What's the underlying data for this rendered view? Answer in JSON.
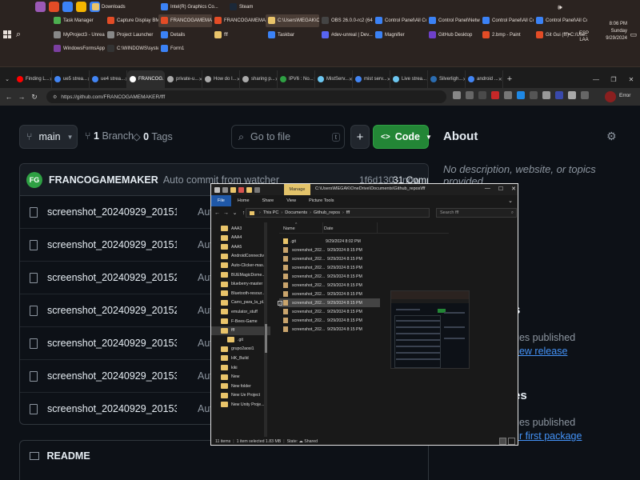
{
  "taskbar": {
    "row1": [
      {
        "label": "Downloads",
        "color": "#e9c46a"
      },
      {
        "label": "Intel(R) Graphics Co...",
        "color": "#3b82f6"
      },
      {
        "label": "Steam",
        "color": "#1b2838"
      }
    ],
    "row2": [
      {
        "label": "Task Manager",
        "color": "#4caf50"
      },
      {
        "label": "Capture Display BMP ...",
        "color": "#e34c26"
      },
      {
        "label": "FRANCOGAMEMAKE...",
        "color": "#e34c26",
        "active": true
      },
      {
        "label": "FRANCOGAMEMAKE...",
        "color": "#e34c26"
      },
      {
        "label": "C:\\Users\\MEGAK\\One...",
        "color": "#e9c46a",
        "active": true
      },
      {
        "label": "OBS 26.0.0-rc2 (64...",
        "color": "#444"
      },
      {
        "label": "Control Panel\\All Cont...",
        "color": "#3b82f6"
      },
      {
        "label": "Control Panel\\Networ...",
        "color": "#3b82f6"
      },
      {
        "label": "Control Panel\\All Cont...",
        "color": "#3b82f6"
      },
      {
        "label": "Control Panel\\All Cont...",
        "color": "#3b82f6"
      }
    ],
    "row3": [
      {
        "label": "MyProject3 - Unreal ...",
        "color": "#888"
      },
      {
        "label": "Project Launcher",
        "color": "#888"
      },
      {
        "label": "Details",
        "color": "#3b82f6"
      },
      {
        "label": "fff",
        "color": "#e9c46a"
      },
      {
        "label": "Taskbar",
        "color": "#3b82f6"
      },
      {
        "label": "#dev-unreal | Dev...",
        "color": "#5865f2"
      },
      {
        "label": "Magnifier",
        "color": "#3b82f6"
      },
      {
        "label": "GitHub Desktop",
        "color": "#6e40c9"
      },
      {
        "label": "2.bmp - Paint",
        "color": "#e34c26"
      },
      {
        "label": "Git Gui (fff) C:/Use...",
        "color": "#e34c26"
      }
    ],
    "row4": [
      {
        "label": "WindowsFormsApp13 - ...",
        "color": "#7b3fa0"
      },
      {
        "label": "C:\\WINDOWS\\system...",
        "color": "#333"
      },
      {
        "label": "Form1",
        "color": "#3b82f6"
      }
    ],
    "tray": {
      "time": "8:06 PM",
      "day": "Sunday",
      "date": "9/29/2024",
      "lang_line1": "ESP",
      "lang_line2": "LAA"
    }
  },
  "browser": {
    "tabs": [
      {
        "title": "Finding L...",
        "color": "#ff0000"
      },
      {
        "title": "ue5 strea...",
        "color": "#4285f4"
      },
      {
        "title": "ue4 strea...",
        "color": "#4285f4"
      },
      {
        "title": "FRANCOG...",
        "color": "#ffffff",
        "active": true
      },
      {
        "title": "private-u...",
        "color": "#aaa"
      },
      {
        "title": "How do I...",
        "color": "#aaa"
      },
      {
        "title": "sharing p...",
        "color": "#aaa"
      },
      {
        "title": "IPV6 : No...",
        "color": "#2ea043"
      },
      {
        "title": "MistServ...",
        "color": "#6cc6f0"
      },
      {
        "title": "mist serv...",
        "color": "#4285f4"
      },
      {
        "title": "Live strea...",
        "color": "#6cc6f0"
      },
      {
        "title": "Silverligh...",
        "color": "#2b6cb0"
      },
      {
        "title": "android ...",
        "color": "#4285f4"
      }
    ],
    "url": "https://github.com/FRANCOGAMEMAKER/fff",
    "profile_status": "Error"
  },
  "github": {
    "branch": "main",
    "branch_count": "1",
    "branch_label": "Branch",
    "tag_count": "0",
    "tag_label": "Tags",
    "goto_placeholder": "Go to file",
    "goto_kbd": "t",
    "plus": "+",
    "code_label": "Code",
    "commit": {
      "avatar": "FG",
      "author": "FRANCOGAMEMAKER",
      "message": "Auto commit from watcher",
      "hash": "1f6d130 · now",
      "commits": "31 Commits"
    },
    "files": [
      {
        "name": "screenshot_20240929_201514.b...",
        "msg": "Auto"
      },
      {
        "name": "screenshot_20240929_201518.b...",
        "msg": "Auto"
      },
      {
        "name": "screenshot_20240929_201522.b...",
        "msg": "Auto"
      },
      {
        "name": "screenshot_20240929_201526.b...",
        "msg": "Auto"
      },
      {
        "name": "screenshot_20240929_201530.b...",
        "msg": "Auto"
      },
      {
        "name": "screenshot_20240929_201534.b...",
        "msg": "Auto"
      },
      {
        "name": "screenshot_20240929_201539.b...",
        "msg": "Auto"
      }
    ],
    "readme": "README",
    "about": {
      "title": "About",
      "description": "No description, website, or topics provided.",
      "activity": "tivity",
      "stars": "ars",
      "watching": "tching",
      "forks": "rks",
      "releases_head": "s",
      "releases_text": "ges published",
      "releases_link": "new release",
      "packages_head": "es",
      "packages_text": "ges published",
      "packages_link": "ur first package"
    }
  },
  "explorer": {
    "manage": "Manage",
    "title": "C:\\Users\\MEGAK\\OneDrive\\Documents\\Github_repos\\fff",
    "ribbon": [
      "File",
      "Home",
      "Share",
      "View",
      "Picture Tools"
    ],
    "crumbs": [
      "This PC",
      "Documents",
      "Github_repos",
      "fff"
    ],
    "search_placeholder": "Search fff",
    "tree": [
      {
        "label": "AAA3"
      },
      {
        "label": "AAA4"
      },
      {
        "label": "AAA5"
      },
      {
        "label": "AndroidConnectiv..."
      },
      {
        "label": "Auto-Clicker-mas..."
      },
      {
        "label": "BUEMagicDome..."
      },
      {
        "label": "blueberry-master"
      },
      {
        "label": "Bluetooth-resour..."
      },
      {
        "label": "Carro_para_la_pl..."
      },
      {
        "label": "emulator_stuff"
      },
      {
        "label": "F-Bees-Game"
      },
      {
        "label": "fff",
        "selected": true
      },
      {
        "label": ".git",
        "sub": true
      },
      {
        "label": "grupo2aosi1"
      },
      {
        "label": "HK_Build"
      },
      {
        "label": "kiki"
      },
      {
        "label": "New"
      },
      {
        "label": "New folder"
      },
      {
        "label": "New Ue Project"
      },
      {
        "label": "New Unity Proje..."
      }
    ],
    "col_name": "Name",
    "col_date": "Date",
    "rows": [
      {
        "name": ".git",
        "date": "9/29/2024 8:02 PM",
        "folder": true
      },
      {
        "name": "screenshot_202...",
        "date": "9/29/2024 8:15 PM"
      },
      {
        "name": "screenshot_202...",
        "date": "9/29/2024 8:15 PM"
      },
      {
        "name": "screenshot_202...",
        "date": "9/29/2024 8:15 PM"
      },
      {
        "name": "screenshot_202...",
        "date": "9/29/2024 8:15 PM"
      },
      {
        "name": "screenshot_202...",
        "date": "9/29/2024 8:15 PM"
      },
      {
        "name": "screenshot_202...",
        "date": "9/29/2024 8:15 PM"
      },
      {
        "name": "screenshot_202...",
        "date": "9/29/2024 8:15 PM",
        "selected": true
      },
      {
        "name": "screenshot_202...",
        "date": "9/29/2024 8:15 PM"
      },
      {
        "name": "screenshot_202...",
        "date": "9/29/2024 8:15 PM"
      },
      {
        "name": "screenshot_202...",
        "date": "9/29/2024 8:15 PM"
      }
    ],
    "status_items": "11 items",
    "status_selected": "1 item selected 1.83 MB",
    "status_state": "State: ☁ Shared"
  }
}
